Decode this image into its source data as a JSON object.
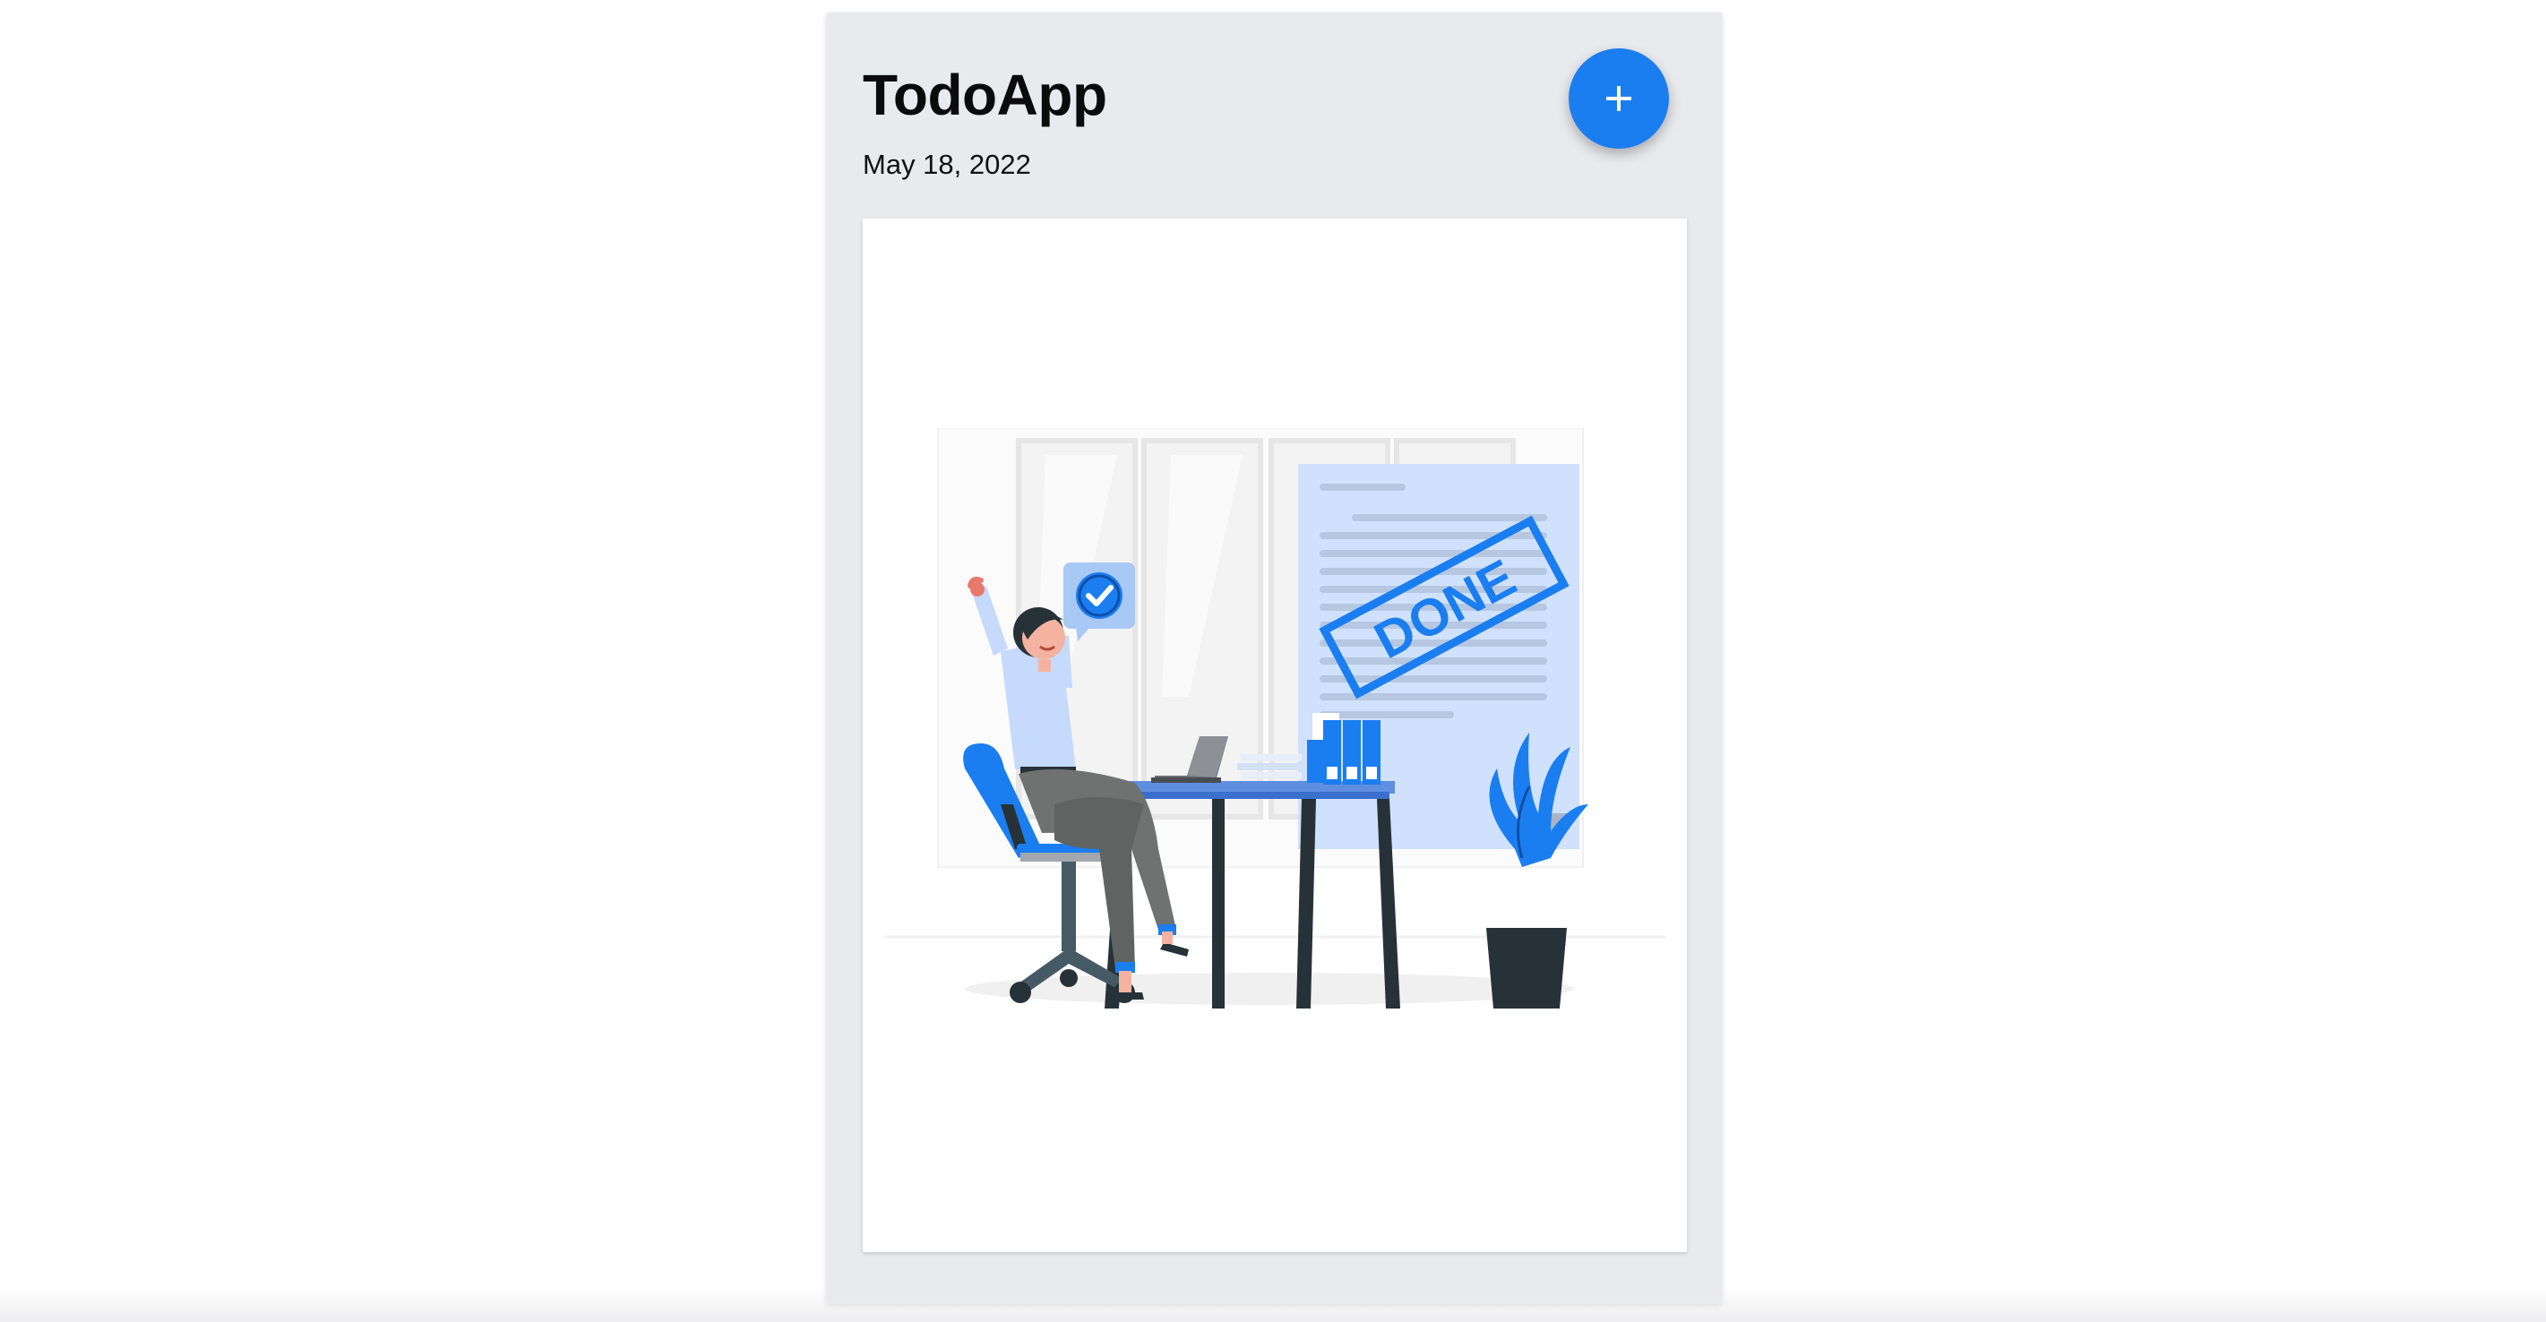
{
  "app": {
    "title": "TodoApp",
    "date": "May 18, 2022"
  },
  "add_button": {
    "icon": "plus-icon",
    "color": "#1a7ef0"
  },
  "illustration": {
    "stamp_text": "DONE",
    "accent": "#1a7ef0"
  },
  "colors": {
    "panel_background": "#e9eaee",
    "card_background": "#ffffff",
    "accent": "#1a7ef0"
  }
}
